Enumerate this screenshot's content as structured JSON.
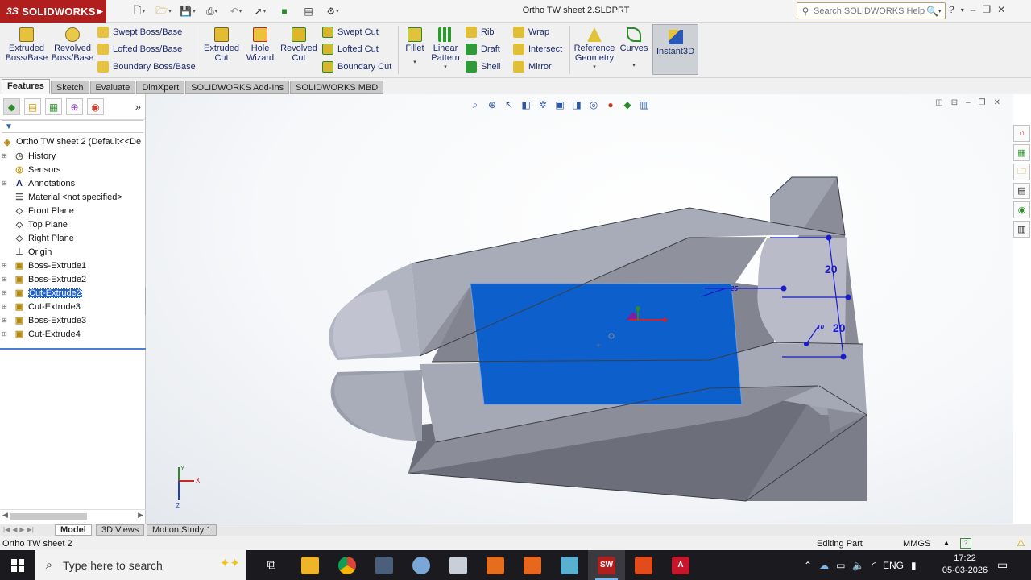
{
  "app": {
    "brand": "SOLIDWORKS",
    "brand_prefix": "3S",
    "document_title": "Ortho TW sheet 2.SLDPRT",
    "search_placeholder": "Search SOLIDWORKS Help"
  },
  "command_manager": {
    "extruded_boss": "Extruded Boss/Base",
    "revolved_boss": "Revolved Boss/Base",
    "swept_boss": "Swept Boss/Base",
    "lofted_boss": "Lofted Boss/Base",
    "boundary_boss": "Boundary Boss/Base",
    "extruded_cut": "Extruded Cut",
    "hole_wizard": "Hole Wizard",
    "revolved_cut": "Revolved Cut",
    "swept_cut": "Swept Cut",
    "lofted_cut": "Lofted Cut",
    "boundary_cut": "Boundary Cut",
    "fillet": "Fillet",
    "linear_pattern": "Linear Pattern",
    "rib": "Rib",
    "draft": "Draft",
    "shell": "Shell",
    "wrap": "Wrap",
    "intersect": "Intersect",
    "mirror": "Mirror",
    "reference_geometry": "Reference Geometry",
    "curves": "Curves",
    "instant3d": "Instant3D"
  },
  "tabs": [
    "Features",
    "Sketch",
    "Evaluate",
    "DimXpert",
    "SOLIDWORKS Add-Ins",
    "SOLIDWORKS MBD"
  ],
  "tree": {
    "root": "Ortho TW sheet 2  (Default<<De",
    "items": [
      {
        "label": "History",
        "icon": "history-icon",
        "expandable": true
      },
      {
        "label": "Sensors",
        "icon": "sensors-icon",
        "expandable": false
      },
      {
        "label": "Annotations",
        "icon": "annotations-icon",
        "expandable": true
      },
      {
        "label": "Material <not specified>",
        "icon": "material-icon",
        "expandable": false
      },
      {
        "label": "Front Plane",
        "icon": "plane-icon",
        "expandable": false
      },
      {
        "label": "Top Plane",
        "icon": "plane-icon",
        "expandable": false
      },
      {
        "label": "Right Plane",
        "icon": "plane-icon",
        "expandable": false
      },
      {
        "label": "Origin",
        "icon": "origin-icon",
        "expandable": false
      },
      {
        "label": "Boss-Extrude1",
        "icon": "boss-extrude-icon",
        "expandable": true
      },
      {
        "label": "Boss-Extrude2",
        "icon": "boss-extrude-icon",
        "expandable": true
      },
      {
        "label": "Cut-Extrude2",
        "icon": "cut-extrude-icon",
        "expandable": true,
        "selected": true
      },
      {
        "label": "Cut-Extrude3",
        "icon": "cut-extrude-icon",
        "expandable": true
      },
      {
        "label": "Boss-Extrude3",
        "icon": "boss-extrude-icon",
        "expandable": true
      },
      {
        "label": "Cut-Extrude4",
        "icon": "cut-extrude-icon",
        "expandable": true
      }
    ]
  },
  "viewport": {
    "dimensions": [
      "20",
      "20",
      "25",
      "10"
    ],
    "triad": {
      "x": "X",
      "y": "Y",
      "z": "Z"
    }
  },
  "bottom_tabs": [
    "Model",
    "3D Views",
    "Motion Study 1"
  ],
  "status": {
    "document": "Ortho TW sheet 2",
    "mode": "Editing Part",
    "units": "MMGS"
  },
  "taskbar": {
    "search_placeholder": "Type here to search",
    "language": "ENG",
    "time": "17:22",
    "date": "05-03-2026"
  },
  "colors": {
    "brand_red": "#b01e1e",
    "part_face": "#9a9daa",
    "selected_face": "#0d5fcb",
    "dimension_blue": "#1a1acb"
  }
}
